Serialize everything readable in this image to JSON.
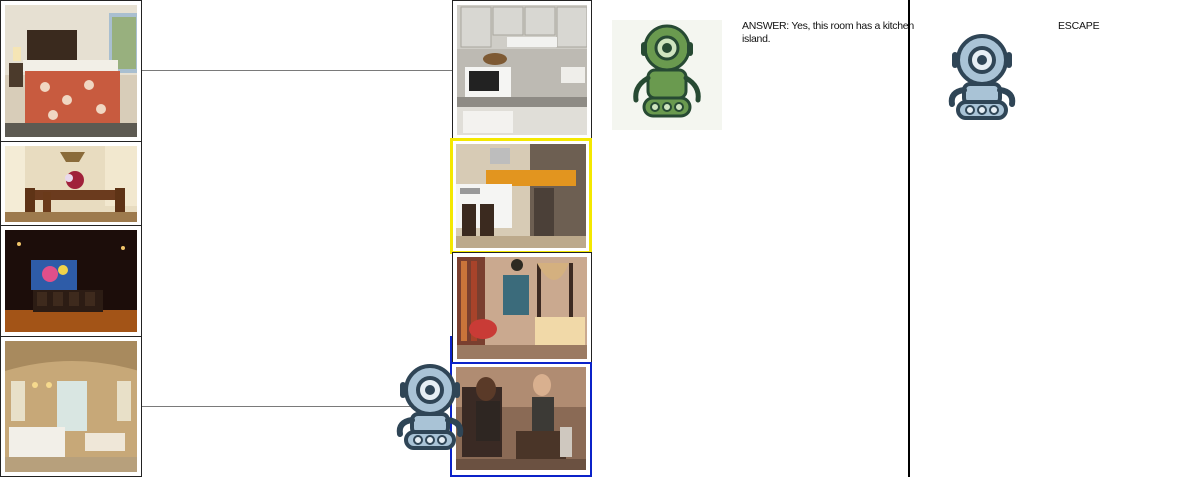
{
  "answer": {
    "text": "ANSWER: Yes, this room has a kitchen island."
  },
  "escape": {
    "label": "ESCAPE"
  },
  "colors": {
    "selected_border": "#f4e800",
    "focused_border": "#0b22c9",
    "divider": "#000000",
    "robot_blue": "#a9c3d6",
    "robot_green": "#6a9a4f"
  },
  "left_column": [
    {
      "name": "hotel-bedroom"
    },
    {
      "name": "dining-room"
    },
    {
      "name": "home-theater"
    },
    {
      "name": "bathroom"
    }
  ],
  "right_column": [
    {
      "name": "kitchen"
    },
    {
      "name": "kitchen-island",
      "selected": true
    },
    {
      "name": "bedroom-canopy"
    },
    {
      "name": "people-in-room",
      "focused": true
    }
  ]
}
